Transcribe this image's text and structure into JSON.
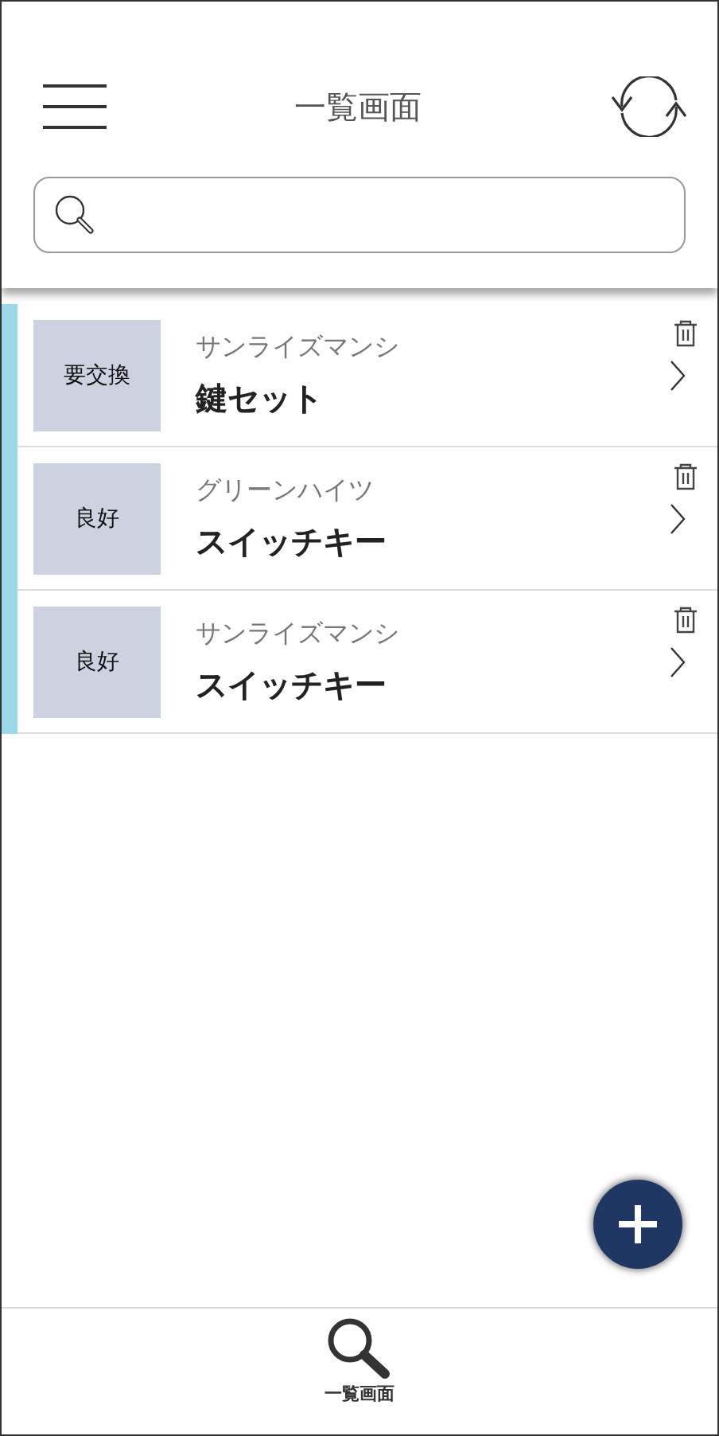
{
  "header": {
    "title": "一覧画面"
  },
  "items": [
    {
      "status": "要交換",
      "building": "サンライズマンシ",
      "name": "鍵セット"
    },
    {
      "status": "良好",
      "building": "グリーンハイツ",
      "name": "スイッチキー"
    },
    {
      "status": "良好",
      "building": "サンライズマンシ",
      "name": "スイッチキー"
    }
  ],
  "bottom_nav": {
    "label": "一覧画面"
  }
}
